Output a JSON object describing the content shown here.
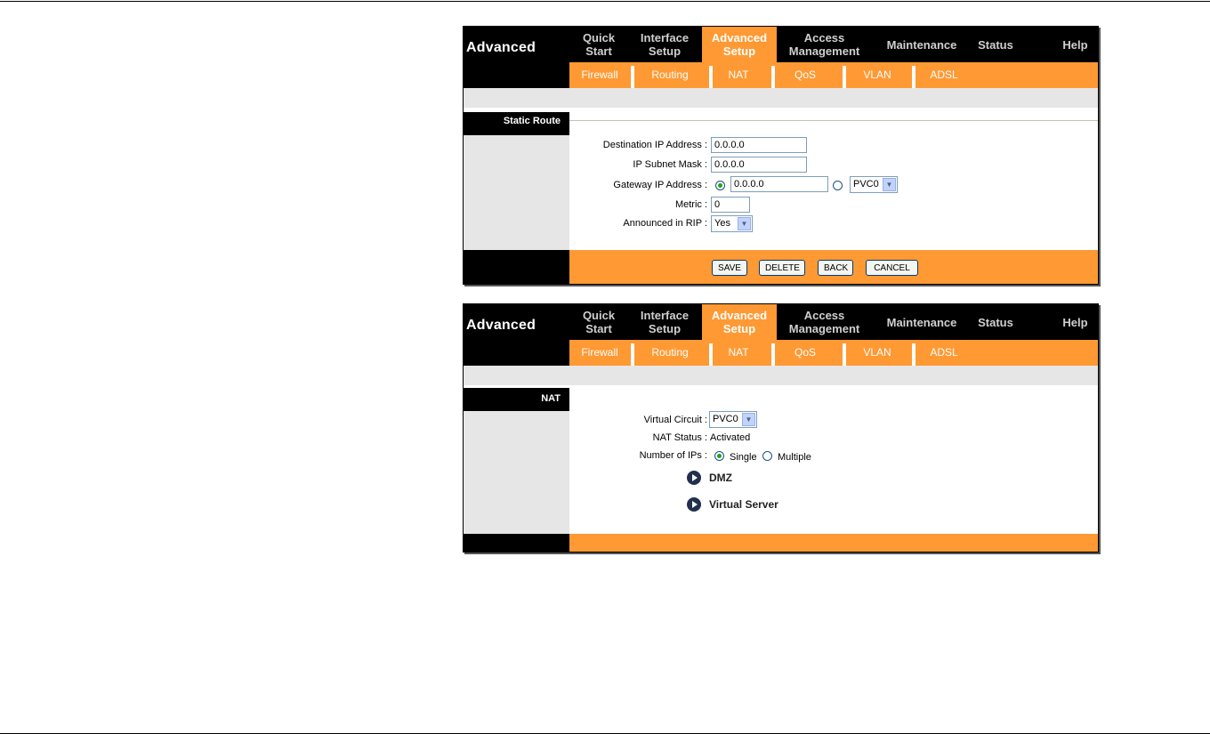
{
  "brand": "Advanced",
  "nav": [
    {
      "line1": "Quick",
      "line2": "Start"
    },
    {
      "line1": "Interface",
      "line2": "Setup"
    },
    {
      "line1": "Advanced",
      "line2": "Setup"
    },
    {
      "line1": "Access",
      "line2": "Management"
    },
    {
      "line1": "Maintenance",
      "line2": ""
    },
    {
      "line1": "Status",
      "line2": ""
    },
    {
      "line1": "Help",
      "line2": ""
    }
  ],
  "subnav": [
    "Firewall",
    "Routing",
    "NAT",
    "QoS",
    "VLAN",
    "ADSL"
  ],
  "static_route": {
    "section_title": "Static Route",
    "dest_label": "Destination IP Address :",
    "dest_value": "0.0.0.0",
    "mask_label": "IP Subnet Mask :",
    "mask_value": "0.0.0.0",
    "gateway_label": "Gateway IP Address :",
    "gateway_value": "0.0.0.0",
    "gateway_pvc": "PVC0",
    "metric_label": "Metric :",
    "metric_value": "0",
    "rip_label": "Announced in RIP :",
    "rip_value": "Yes",
    "buttons": {
      "save": "SAVE",
      "delete": "DELETE",
      "back": "BACK",
      "cancel": "CANCEL"
    }
  },
  "nat": {
    "section_title": "NAT",
    "vc_label": "Virtual Circuit :",
    "vc_value": "PVC0",
    "status_label": "NAT Status :",
    "status_value": "Activated",
    "ips_label": "Number of IPs :",
    "ips_single": "Single",
    "ips_multiple": "Multiple",
    "dmz": "DMZ",
    "virtual_server": "Virtual Server"
  },
  "colors": {
    "accent": "#ff9933",
    "header": "#000000",
    "band": "#e6e6e6"
  }
}
